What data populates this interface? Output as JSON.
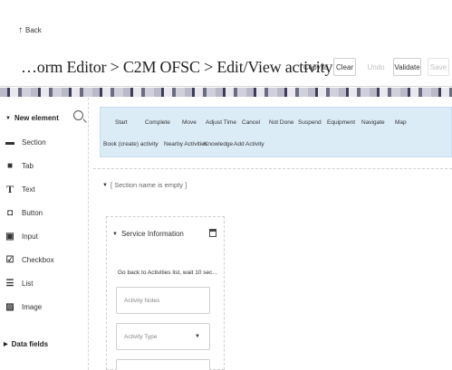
{
  "header": {
    "back_label": "Back",
    "back_icon": "arrow-up-icon",
    "title": "…orm Editor > C2M OFSC > Edit/View activity",
    "copy_to_label": "Copy to",
    "clear_label": "Clear",
    "undo_label": "Undo",
    "validate_label": "Validate",
    "save_label": "Save"
  },
  "palette": {
    "new_element_label": "New element",
    "items": [
      {
        "label": "Section",
        "icon": "section-icon"
      },
      {
        "label": "Tab",
        "icon": "tab-icon"
      },
      {
        "label": "Text",
        "icon": "text-icon"
      },
      {
        "label": "Button",
        "icon": "button-icon"
      },
      {
        "label": "Input",
        "icon": "input-icon"
      },
      {
        "label": "Checkbox",
        "icon": "checkbox-icon"
      },
      {
        "label": "List",
        "icon": "list-icon"
      },
      {
        "label": "Image",
        "icon": "image-icon"
      }
    ],
    "data_fields_label": "Data fields"
  },
  "canvas": {
    "actions_row1": [
      "Start",
      "Complete",
      "Move",
      "Adjust Time",
      "Cancel",
      "Not Done",
      "Suspend",
      "Equipment",
      "Navigate",
      "Map"
    ],
    "actions_row2": [
      "Book (create) activity",
      "Nearby Activities",
      "Knowledge",
      "Add Activity"
    ],
    "section_name": "[ Section name is empty ]",
    "service_section": {
      "title": "Service Information",
      "go_back_text": "Go back to Activities list, wait 10 sec…",
      "notes_placeholder": "Activity Notes",
      "type_placeholder": "Activity Type"
    }
  },
  "colors": {
    "actions_bar_bg": "#dcecf7"
  }
}
